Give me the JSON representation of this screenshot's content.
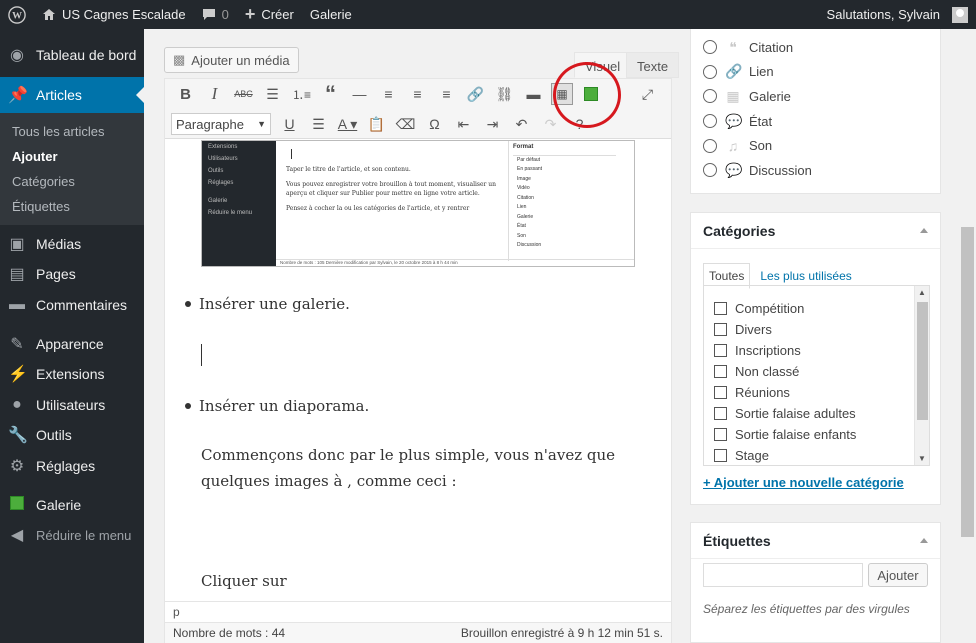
{
  "adminbar": {
    "site_name": "US Cagnes Escalade",
    "comments_count": "0",
    "new_label": "Créer",
    "gallery_label": "Galerie",
    "greeting": "Salutations, Sylvain"
  },
  "sidebar": {
    "dashboard": "Tableau de bord",
    "articles": "Articles",
    "sub": [
      "Tous les articles",
      "Ajouter",
      "Catégories",
      "Étiquettes"
    ],
    "media": "Médias",
    "pages": "Pages",
    "comments": "Commentaires",
    "appearance": "Apparence",
    "extensions": "Extensions",
    "users": "Utilisateurs",
    "tools": "Outils",
    "settings": "Réglages",
    "gallery": "Galerie",
    "collapse": "Réduire le menu"
  },
  "editor": {
    "add_media": "Ajouter un média",
    "tab_visual": "Visuel",
    "tab_text": "Texte",
    "format_select": "Paragraphe",
    "bullet1": "Insérer une galerie.",
    "bullet2": "Insérer un diaporama.",
    "para1": "Commençons donc par le plus simple, vous n'avez que",
    "para2": "quelques images à , comme ceci :",
    "para3": "Cliquer sur",
    "path": "p",
    "word_count": "Nombre de mots : 44",
    "draft_saved": "Brouillon enregistré à 9 h 12 min 51 s."
  },
  "embedded_screenshot": {
    "sidebar": [
      "Extensions",
      "Utilisateurs",
      "Outils",
      "Réglages",
      "Galerie",
      "Réduire le menu"
    ],
    "text1": "Taper le titre de l'article, et son contenu.",
    "text2": "Vous pouvez enregistrer votre brouillon à tout moment, visualiser un aperçu et cliquer sur Publier pour mettre en ligne votre article.",
    "text3": "Pensez à cocher la ou les catégories de l'article, et y rentrer",
    "format_title": "Format",
    "formats": [
      "Par défaut",
      "En passant",
      "Image",
      "Vidéo",
      "Citation",
      "Lien",
      "Galerie",
      "État",
      "Son",
      "Discussion"
    ],
    "status": "Nombre de mots : 105        Dernière modification par Sylvain, le 20 octobre 2015 à 8 h 44 min"
  },
  "format_panel": {
    "items": [
      {
        "label": "Citation",
        "icon": "quote-icon"
      },
      {
        "label": "Lien",
        "icon": "link-icon"
      },
      {
        "label": "Galerie",
        "icon": "gallery-icon"
      },
      {
        "label": "État",
        "icon": "status-icon"
      },
      {
        "label": "Son",
        "icon": "audio-icon"
      },
      {
        "label": "Discussion",
        "icon": "chat-icon"
      }
    ]
  },
  "categories": {
    "title": "Catégories",
    "tab_all": "Toutes",
    "tab_popular": "Les plus utilisées",
    "items": [
      "Compétition",
      "Divers",
      "Inscriptions",
      "Non classé",
      "Réunions",
      "Sortie falaise adultes",
      "Sortie falaise enfants",
      "Stage"
    ],
    "add_new": "+ Ajouter une nouvelle catégorie"
  },
  "tags": {
    "title": "Étiquettes",
    "add_button": "Ajouter",
    "hint": "Séparez les étiquettes par des virgules"
  },
  "colors": {
    "adminbar": "#23282d",
    "accent": "#0073aa",
    "highlight_circle": "#d6181e",
    "gallery_green": "#4cae3c"
  }
}
